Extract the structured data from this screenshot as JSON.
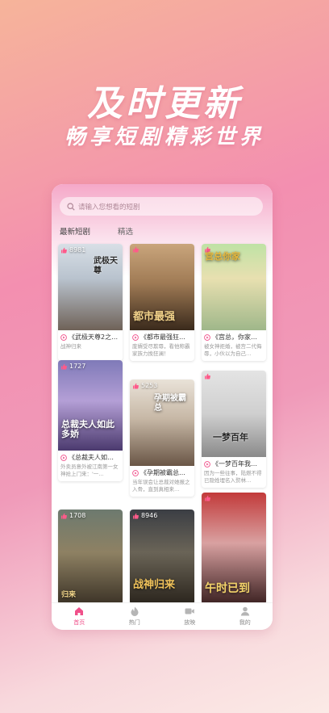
{
  "hero": {
    "title": "及时更新",
    "subtitle": "畅享短剧精彩世界"
  },
  "search": {
    "placeholder": "请输入您想看的短剧"
  },
  "tabs": [
    {
      "label": "最新短剧"
    },
    {
      "label": "精选"
    }
  ],
  "cards": [
    {
      "count": "8981",
      "poster_text": "武极天尊",
      "title": "《武极天尊2之…",
      "desc": "战神归来"
    },
    {
      "count": "",
      "poster_text": "都市最强",
      "title": "《都市最强狂…",
      "desc": "废婿受尽欺辱，看他称霸家族力挽狂澜！"
    },
    {
      "count": "",
      "poster_text": "宫总你家",
      "title": "《宫总，你家…",
      "desc": "被女神拒婚，被宫二代侮辱，小伙以为自己…"
    },
    {
      "count": "1727",
      "poster_text": "总裁夫人如此多娇",
      "title": "《总裁夫人如…",
      "desc": "外卖员意外被江南第一女神抢上门来：'一…"
    },
    {
      "count": "5253",
      "poster_text": "孕期被霸总",
      "title": "《孕期被霸总…",
      "desc": "当年误会让总裁对她报之入骨，直到真相来…"
    },
    {
      "count": "",
      "poster_text": "一梦百年",
      "title": "《一梦百年我…",
      "desc": "因为一些往事，陆燃不得已隐姓埋名入赘林…"
    },
    {
      "count": "1708",
      "poster_text": "归来",
      "title": "",
      "desc": ""
    },
    {
      "count": "8946",
      "poster_text": "战神归来",
      "title": "",
      "desc": ""
    },
    {
      "count": "",
      "poster_text": "午时已到",
      "title": "",
      "desc": ""
    }
  ],
  "tabbar": [
    {
      "label": "首页",
      "icon": "home-icon",
      "active": true
    },
    {
      "label": "热门",
      "icon": "flame-icon",
      "active": false
    },
    {
      "label": "放映",
      "icon": "video-icon",
      "active": false
    },
    {
      "label": "我的",
      "icon": "user-icon",
      "active": false
    }
  ],
  "colors": {
    "accent": "#f0508a",
    "brand_pink": "#f38fb0"
  }
}
